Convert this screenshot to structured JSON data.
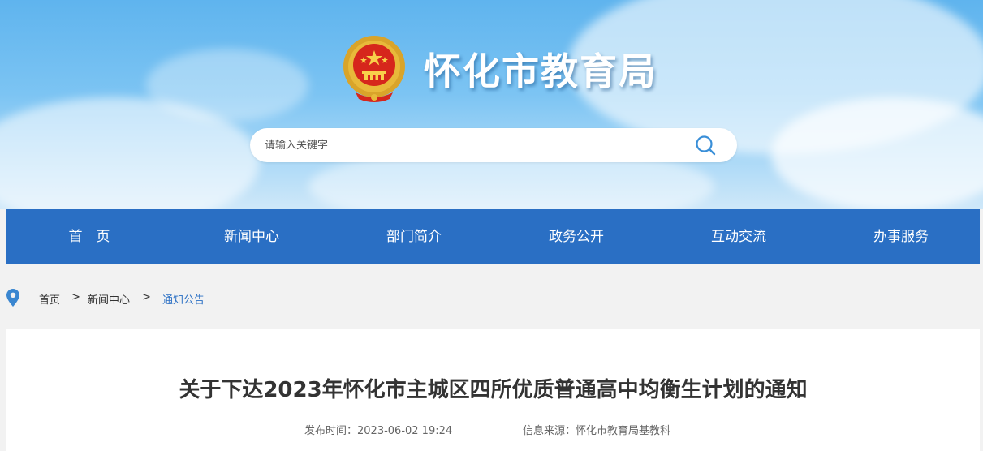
{
  "header": {
    "site_title": "怀化市教育局",
    "search_placeholder": "请输入关键字"
  },
  "nav": {
    "items": [
      {
        "label": "首　页"
      },
      {
        "label": "新闻中心"
      },
      {
        "label": "部门简介"
      },
      {
        "label": "政务公开"
      },
      {
        "label": "互动交流"
      },
      {
        "label": "办事服务"
      }
    ],
    "color": "#2a6fc4"
  },
  "breadcrumb": {
    "items": [
      {
        "label": "首页"
      },
      {
        "label": "新闻中心"
      },
      {
        "label": "通知公告"
      }
    ],
    "separator": ">"
  },
  "article": {
    "title": "关于下达2023年怀化市主城区四所优质普通高中均衡生计划的通知",
    "published": "发布时间：2023-06-02 19:24",
    "source": "信息来源：怀化市教育局基教科"
  }
}
